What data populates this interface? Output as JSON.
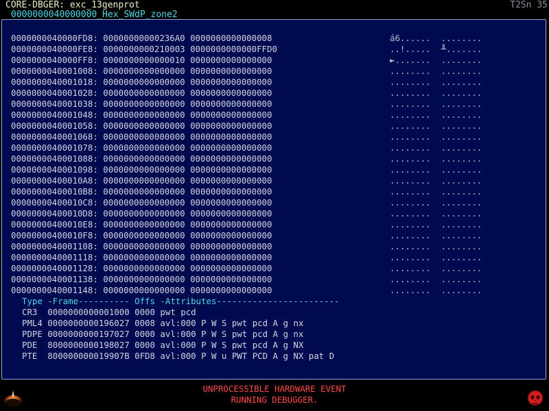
{
  "window": {
    "title": "CORE-DBGER: exc_13genprot",
    "tab": "0000000040000000_Hex_SWdP_zone2",
    "corner": "T2Sn 35"
  },
  "hex_rows": [
    "0000000040000FD8: 00000000000236A0 0000000000000008",
    "0000000040000FE8: 0000000000210003 0000000000000FFD0",
    "0000000040000FF8: 0000000000000010 0000000000000000",
    "0000000040001008: 0000000000000000 0000000000000000",
    "0000000040001018: 0000000000000000 0000000000000000",
    "0000000040001028: 0000000000000000 0000000000000000",
    "0000000040001038: 0000000000000000 0000000000000000",
    "0000000040001048: 0000000000000000 0000000000000000",
    "0000000040001058: 0000000000000000 0000000000000000",
    "0000000040001068: 0000000000000000 0000000000000000",
    "0000000040001078: 0000000000000000 0000000000000000",
    "0000000040001088: 0000000000000000 0000000000000000",
    "0000000040001098: 0000000000000000 0000000000000000",
    "00000000400010A8: 0000000000000000 0000000000000000",
    "00000000400010B8: 0000000000000000 0000000000000000",
    "00000000400010C8: 0000000000000000 0000000000000000",
    "00000000400010D8: 0000000000000000 0000000000000000",
    "00000000400010E8: 0000000000000000 0000000000000000",
    "00000000400010F8: 0000000000000000 0000000000000000",
    "0000000040001108: 0000000000000000 0000000000000000",
    "0000000040001118: 0000000000000000 0000000000000000",
    "0000000040001128: 0000000000000000 0000000000000000",
    "0000000040001138: 0000000000000000 0000000000000000",
    "0000000040001148: 0000000000000000 0000000000000000"
  ],
  "ascii_rows": [
    "á6......  ........",
    "..!.....  ╨.......",
    "►.......  ........",
    "........  ........",
    "........  ........",
    "........  ........",
    "........  ........",
    "........  ........",
    "........  ........",
    "........  ........",
    "........  ........",
    "........  ........",
    "........  ........",
    "........  ........",
    "........  ........",
    "........  ........",
    "........  ........",
    "........  ........",
    "........  ........",
    "........  ........",
    "........  ........",
    "........  ........",
    "........  ........",
    "........  ........"
  ],
  "page_table": {
    "header": "Type -Frame---------- Offs -Attributes------------------------",
    "rows": [
      "CR3  0000000000001000 0000 pwt pcd",
      "PML4 0000000000196027 0008 avl:000 P W S pwt pcd A g nx",
      "PDPE 0000000000197027 0000 avl:000 P W S pwt pcd A g nx",
      "PDE  8000000000198027 0000 avl:000 P W S pwt pcd A g NX",
      "PTE  800000000019907B 0FD8 avl:000 P W u PWT PCD A g NX pat D"
    ]
  },
  "status": {
    "line1": "UNPROCESSIBLE HARDWARE EVENT",
    "line2": "RUNNING DEBUGGER."
  },
  "icons": {
    "left": "eclipse-logo-icon",
    "right": "red-skull-icon"
  },
  "colors": {
    "panel_bg": "#000a4e",
    "accent": "#4fd8e8",
    "alert": "#ff4a4a"
  }
}
